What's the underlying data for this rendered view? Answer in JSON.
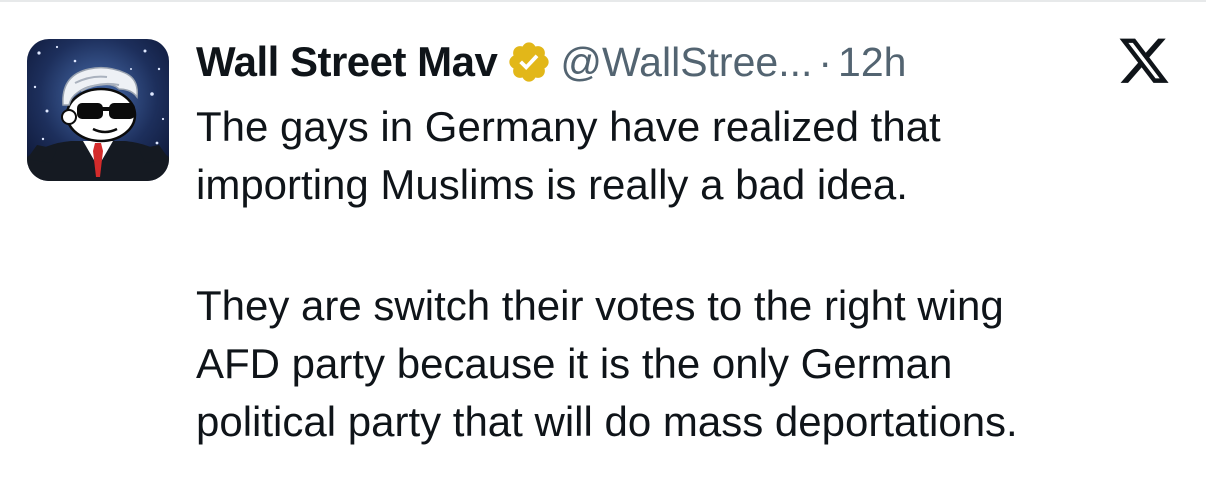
{
  "author": {
    "display_name": "Wall Street Mav",
    "handle": "@WallStree...",
    "separator": "·",
    "timestamp": "12h",
    "verified_icon": "verified-badge-icon",
    "verified_color": "#e2b719"
  },
  "brand": {
    "logo_icon": "x-logo-icon"
  },
  "tweet": {
    "paragraph_1_line_1": "The gays in Germany have realized that",
    "paragraph_1_line_2": "importing Muslims is really a bad idea.",
    "paragraph_2_line_1": "They are switch their votes to the right wing",
    "paragraph_2_line_2": "AFD party because it is the only German",
    "paragraph_2_line_3": "political party that will do mass deportations."
  },
  "colors": {
    "text_primary": "#0f1419",
    "text_secondary": "#536471",
    "background": "#ffffff"
  }
}
